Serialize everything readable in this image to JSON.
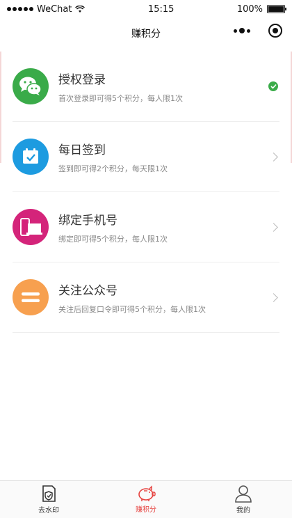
{
  "status_bar": {
    "carrier": "WeChat",
    "time": "15:15",
    "battery": "100%",
    "battery_level": 1.0
  },
  "nav": {
    "title": "赚积分"
  },
  "items": [
    {
      "title": "授权登录",
      "desc": "首次登录即可得5个积分，每人限1次",
      "icon": "wechat-icon",
      "color": "#3aab49",
      "status": "done"
    },
    {
      "title": "每日签到",
      "desc": "签到即可得2个积分，每天限1次",
      "icon": "calendar-check-icon",
      "color": "#1d9be0",
      "status": "todo"
    },
    {
      "title": "绑定手机号",
      "desc": "绑定即可得5个积分，每人限1次",
      "icon": "phone-laptop-icon",
      "color": "#d4247a",
      "status": "todo"
    },
    {
      "title": "关注公众号",
      "desc": "关注后回复口令即可得5个积分，每人限1次",
      "icon": "equals-icon",
      "color": "#f7a04f",
      "status": "todo"
    }
  ],
  "tabs": [
    {
      "label": "去水印",
      "icon": "shield-doc-icon",
      "active": false
    },
    {
      "label": "赚积分",
      "icon": "piggy-bank-icon",
      "active": true
    },
    {
      "label": "我的",
      "icon": "user-icon",
      "active": false
    }
  ],
  "colors": {
    "accent": "#e64340",
    "done": "#3aab49"
  }
}
